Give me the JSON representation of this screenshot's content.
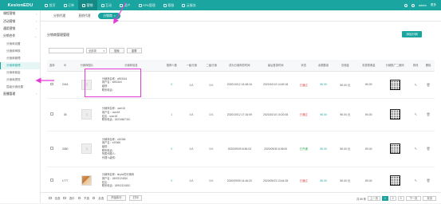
{
  "app": {
    "logo": "KesionEDU"
  },
  "topnav": [
    {
      "label": "首页",
      "icon": "home-icon"
    },
    {
      "label": "订单",
      "icon": "order-icon"
    },
    {
      "label": "营销",
      "icon": "marketing-icon",
      "active": true
    },
    {
      "label": "互动",
      "icon": "chat-icon"
    },
    {
      "label": "用户",
      "icon": "user-icon"
    },
    {
      "label": "SPA管理",
      "icon": "app-icon"
    },
    {
      "label": "客服",
      "icon": "service-icon"
    },
    {
      "label": "云服务",
      "icon": "cloud-icon"
    }
  ],
  "topright": {
    "user": "admin",
    "menu": "更多"
  },
  "sidebar": {
    "groups": [
      {
        "label": "课程营销"
      },
      {
        "label": "活动营销"
      },
      {
        "label": "通用营销"
      },
      {
        "label": "分销合作",
        "expanded": true,
        "items": [
          {
            "label": "分销商设置"
          },
          {
            "label": "分销商审核"
          },
          {
            "label": "分销商管理"
          },
          {
            "label": "分销商管理",
            "active": true
          },
          {
            "label": "分销商佣金"
          },
          {
            "label": "分销商提现"
          },
          {
            "label": "层级分销设置"
          }
        ]
      },
      {
        "label": "直播管理"
      }
    ]
  },
  "tabs": [
    {
      "label": "分销代理"
    },
    {
      "label": "直销代理"
    },
    {
      "label": "分销商",
      "active": true,
      "close": "×"
    }
  ],
  "page": {
    "title": "分销商管理管理",
    "add_button": "添加分销"
  },
  "filters": {
    "select_value": "全部类",
    "search_button": "搜索",
    "reset_button": "重置"
  },
  "table": {
    "headers": [
      "选择",
      "ID",
      "分销商图片",
      "分销商信息",
      "推荐人数",
      "一级分销",
      "二级分销",
      "成为分销商的时间",
      "最后登录时间",
      "状态",
      "余额数量",
      "总佣金",
      "未提现佣金",
      "分销推广二维码",
      "修改",
      "删除"
    ],
    "rows": [
      {
        "id": "2444",
        "thumb": "无",
        "info": [
          "分销商名称：z853164",
          "用户名：z853164",
          "级别：",
          "联系电话："
        ],
        "referrals": "0",
        "l1": "0人",
        "l2": "0人",
        "joined": "2020/10/12 14:48:16",
        "last_login": "2020/10/13 14:49:18",
        "status": "已通过",
        "status_color": "red",
        "balance": "¥0.00",
        "total": "¥0.00 元",
        "pending": "¥0.00"
      },
      {
        "id": "38",
        "thumb": "无",
        "info": [
          "分销商名称：user18",
          "用户名：user18",
          "姓名：user18",
          "联系电话：18234567310"
        ],
        "referrals": "1",
        "l1": "0人",
        "l2": "0人",
        "joined": "2020/10/12 17:16:09",
        "last_login": "2020/10/10 10:20:08",
        "status": "已通过",
        "status_color": "red",
        "balance": "¥0.00",
        "total": "¥0.00 元",
        "pending": "¥0.00"
      },
      {
        "id": "3380",
        "thumb": "无",
        "info": [
          "分销商名称：v30366",
          "用户名：v30366",
          "级别：",
          "联系电话：",
          "所属代理人：",
          "代理人级别："
        ],
        "referrals": "0",
        "l1": "0人",
        "l2": "0人",
        "joined": "2020/09/09 8:36:03",
        "last_login": "2020/09/30 8:36:00",
        "status": "已开通",
        "status_color": "green",
        "balance": "¥0.00",
        "total": "¥0.00 元",
        "pending": "¥0.00"
      },
      {
        "id": "1777",
        "thumb": "dog",
        "info": [
          "分销商名称：tinyhx的分销商",
          "用户名：18002124810",
          "姓名：",
          "联系电话：18902124810"
        ],
        "referrals": "0",
        "l1": "0人",
        "l2": "0人",
        "joined": "2020/09/09 14:46:20",
        "last_login": "2020/09/23 13:44:28",
        "status": "已通过",
        "status_color": "red",
        "balance": "¥0.00",
        "total": "¥0.00 元",
        "pending": "¥0.00"
      }
    ]
  },
  "footer": {
    "checks": [
      "全选",
      "选中",
      "不选",
      "反选"
    ],
    "batch_button": "开始执行",
    "export_button": "打印",
    "pager": {
      "total": "共 85 条",
      "pages": [
        "1",
        "2",
        "3"
      ],
      "prev": "上一页",
      "next": "下一页",
      "last": "末页",
      "current": "1"
    }
  },
  "colors": {
    "accent": "#1aa5a0",
    "highlight": "#e53ad6"
  }
}
